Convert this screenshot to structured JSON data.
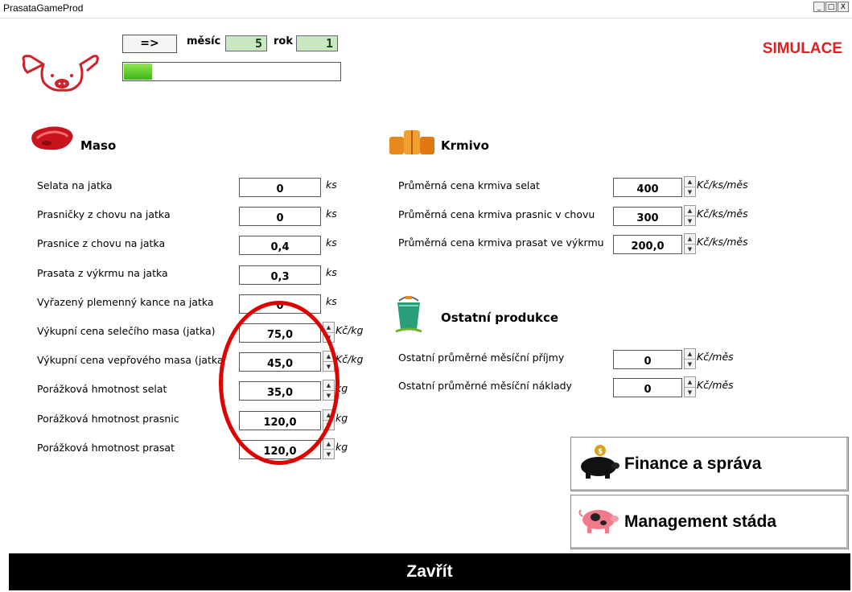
{
  "window": {
    "title": "PrasataGameProd",
    "controls": [
      "_",
      "□",
      "X"
    ]
  },
  "top": {
    "next_button": "=>",
    "month_label": "měsíc",
    "month_value": "5",
    "year_label": "rok",
    "year_value": "1",
    "progress_fraction": 0.13,
    "mode": "SIMULACE"
  },
  "maso": {
    "title": "Maso",
    "rows": [
      {
        "label": "Selata na jatka",
        "value": "0",
        "unit": "ks"
      },
      {
        "label": "Prasničky z chovu na jatka",
        "value": "0",
        "unit": "ks"
      },
      {
        "label": "Prasnice z chovu na jatka",
        "value": "0,4",
        "unit": "ks"
      },
      {
        "label": "Prasata z výkrmu na jatka",
        "value": "0,3",
        "unit": "ks"
      },
      {
        "label": "Vyřazený plemenný kance na jatka",
        "value": "0",
        "unit": "ks"
      },
      {
        "label": "Výkupní cena selečího masa (jatka)",
        "value": "75,0",
        "unit": "Kč/kg"
      },
      {
        "label": "Výkupní cena vepřového masa (jatka",
        "value": "45,0",
        "unit": "Kč/kg"
      },
      {
        "label": "Porážková hmotnost selat",
        "value": "35,0",
        "unit": "kg"
      },
      {
        "label": "Porážková hmotnost prasnic",
        "value": "120,0",
        "unit": "kg"
      },
      {
        "label": "Porážková hmotnost prasat",
        "value": "120,0",
        "unit": "kg"
      }
    ]
  },
  "krmivo": {
    "title": "Krmivo",
    "rows": [
      {
        "label": "Průměrná cena krmiva selat",
        "value": "400",
        "unit": "Kč/ks/měs"
      },
      {
        "label": "Průměrná cena krmiva prasnic v chovu",
        "value": "300",
        "unit": "Kč/ks/měs"
      },
      {
        "label": "Průměrná cena krmiva prasat ve výkrmu",
        "value": "200,0",
        "unit": "Kč/ks/měs"
      }
    ]
  },
  "ostatni": {
    "title": "Ostatní produkce",
    "rows": [
      {
        "label": "Ostatní průměrné měsíční příjmy",
        "value": "0",
        "unit": "Kč/měs"
      },
      {
        "label": "Ostatní průměrné měsíční náklady",
        "value": "0",
        "unit": "Kč/měs"
      }
    ]
  },
  "buttons": {
    "finance": "Finance a správa",
    "management": "Management stáda",
    "close": "Zavřít"
  },
  "icons": {
    "logo": "pig-head-icon",
    "maso": "meat-icon",
    "krmivo": "hay-bales-icon",
    "ostatni": "milk-bucket-icon",
    "finance": "piggy-bank-icon",
    "management": "pig-icon"
  },
  "colors": {
    "accent_red": "#e02020",
    "progress_green": "#5ccf28",
    "close_bar": "#000000"
  }
}
